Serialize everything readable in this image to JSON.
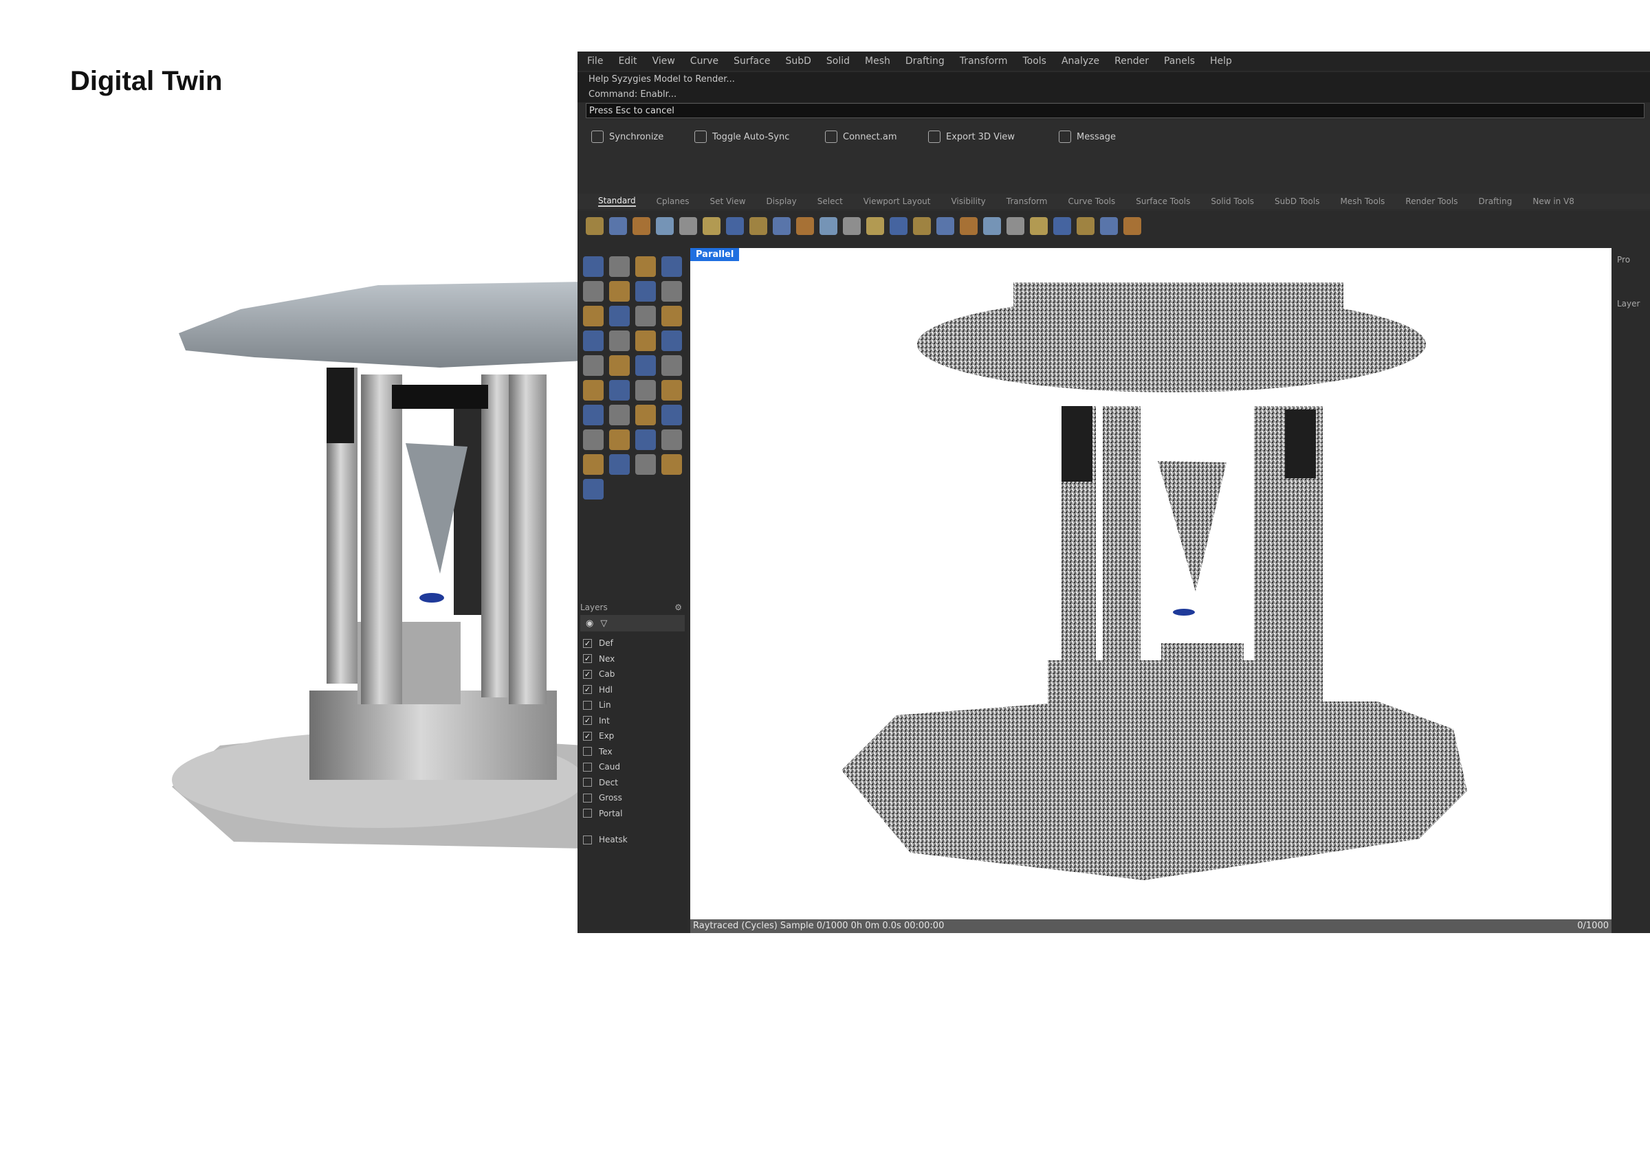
{
  "page": {
    "title": "Digital Twin"
  },
  "app": {
    "menu": [
      "File",
      "Edit",
      "View",
      "Curve",
      "Surface",
      "SubD",
      "Solid",
      "Mesh",
      "Drafting",
      "Transform",
      "Tools",
      "Analyze",
      "Render",
      "Panels",
      "Help"
    ],
    "command_history": [
      "Help Syzygies Model to Render...",
      "Command: Enablr..."
    ],
    "command_prompt": "Press Esc to cancel",
    "plugin_buttons": [
      "Synchronize",
      "Toggle Auto-Sync",
      "Connect.am",
      "Export 3D View",
      "Message"
    ],
    "tabs": [
      "Standard",
      "Cplanes",
      "Set View",
      "Display",
      "Select",
      "Viewport Layout",
      "Visibility",
      "Transform",
      "Curve Tools",
      "Surface Tools",
      "Solid Tools",
      "SubD Tools",
      "Mesh Tools",
      "Render Tools",
      "Drafting",
      "New in V8"
    ],
    "viewport_label": "Parallel",
    "statusbar": {
      "left": "Raytraced (Cycles)   Sample 0/1000  0h 0m 0.0s   00:00:00",
      "right": "0/1000"
    },
    "layers": {
      "title": "Layers",
      "items": [
        {
          "name": "Def",
          "checked": true
        },
        {
          "name": "Nex",
          "checked": true
        },
        {
          "name": "Cab",
          "checked": true
        },
        {
          "name": "Hdl",
          "checked": true
        },
        {
          "name": "Lin",
          "checked": false
        },
        {
          "name": "Int",
          "checked": true
        },
        {
          "name": "Exp",
          "checked": true
        },
        {
          "name": "Tex",
          "checked": false
        },
        {
          "name": "Caud",
          "checked": false
        },
        {
          "name": "Dect",
          "checked": false
        },
        {
          "name": "Gross",
          "checked": false
        },
        {
          "name": "Portal",
          "checked": false
        },
        {
          "name": "Heatsk",
          "checked": false
        }
      ]
    },
    "right_panel": [
      "Pro",
      "Layer"
    ]
  }
}
